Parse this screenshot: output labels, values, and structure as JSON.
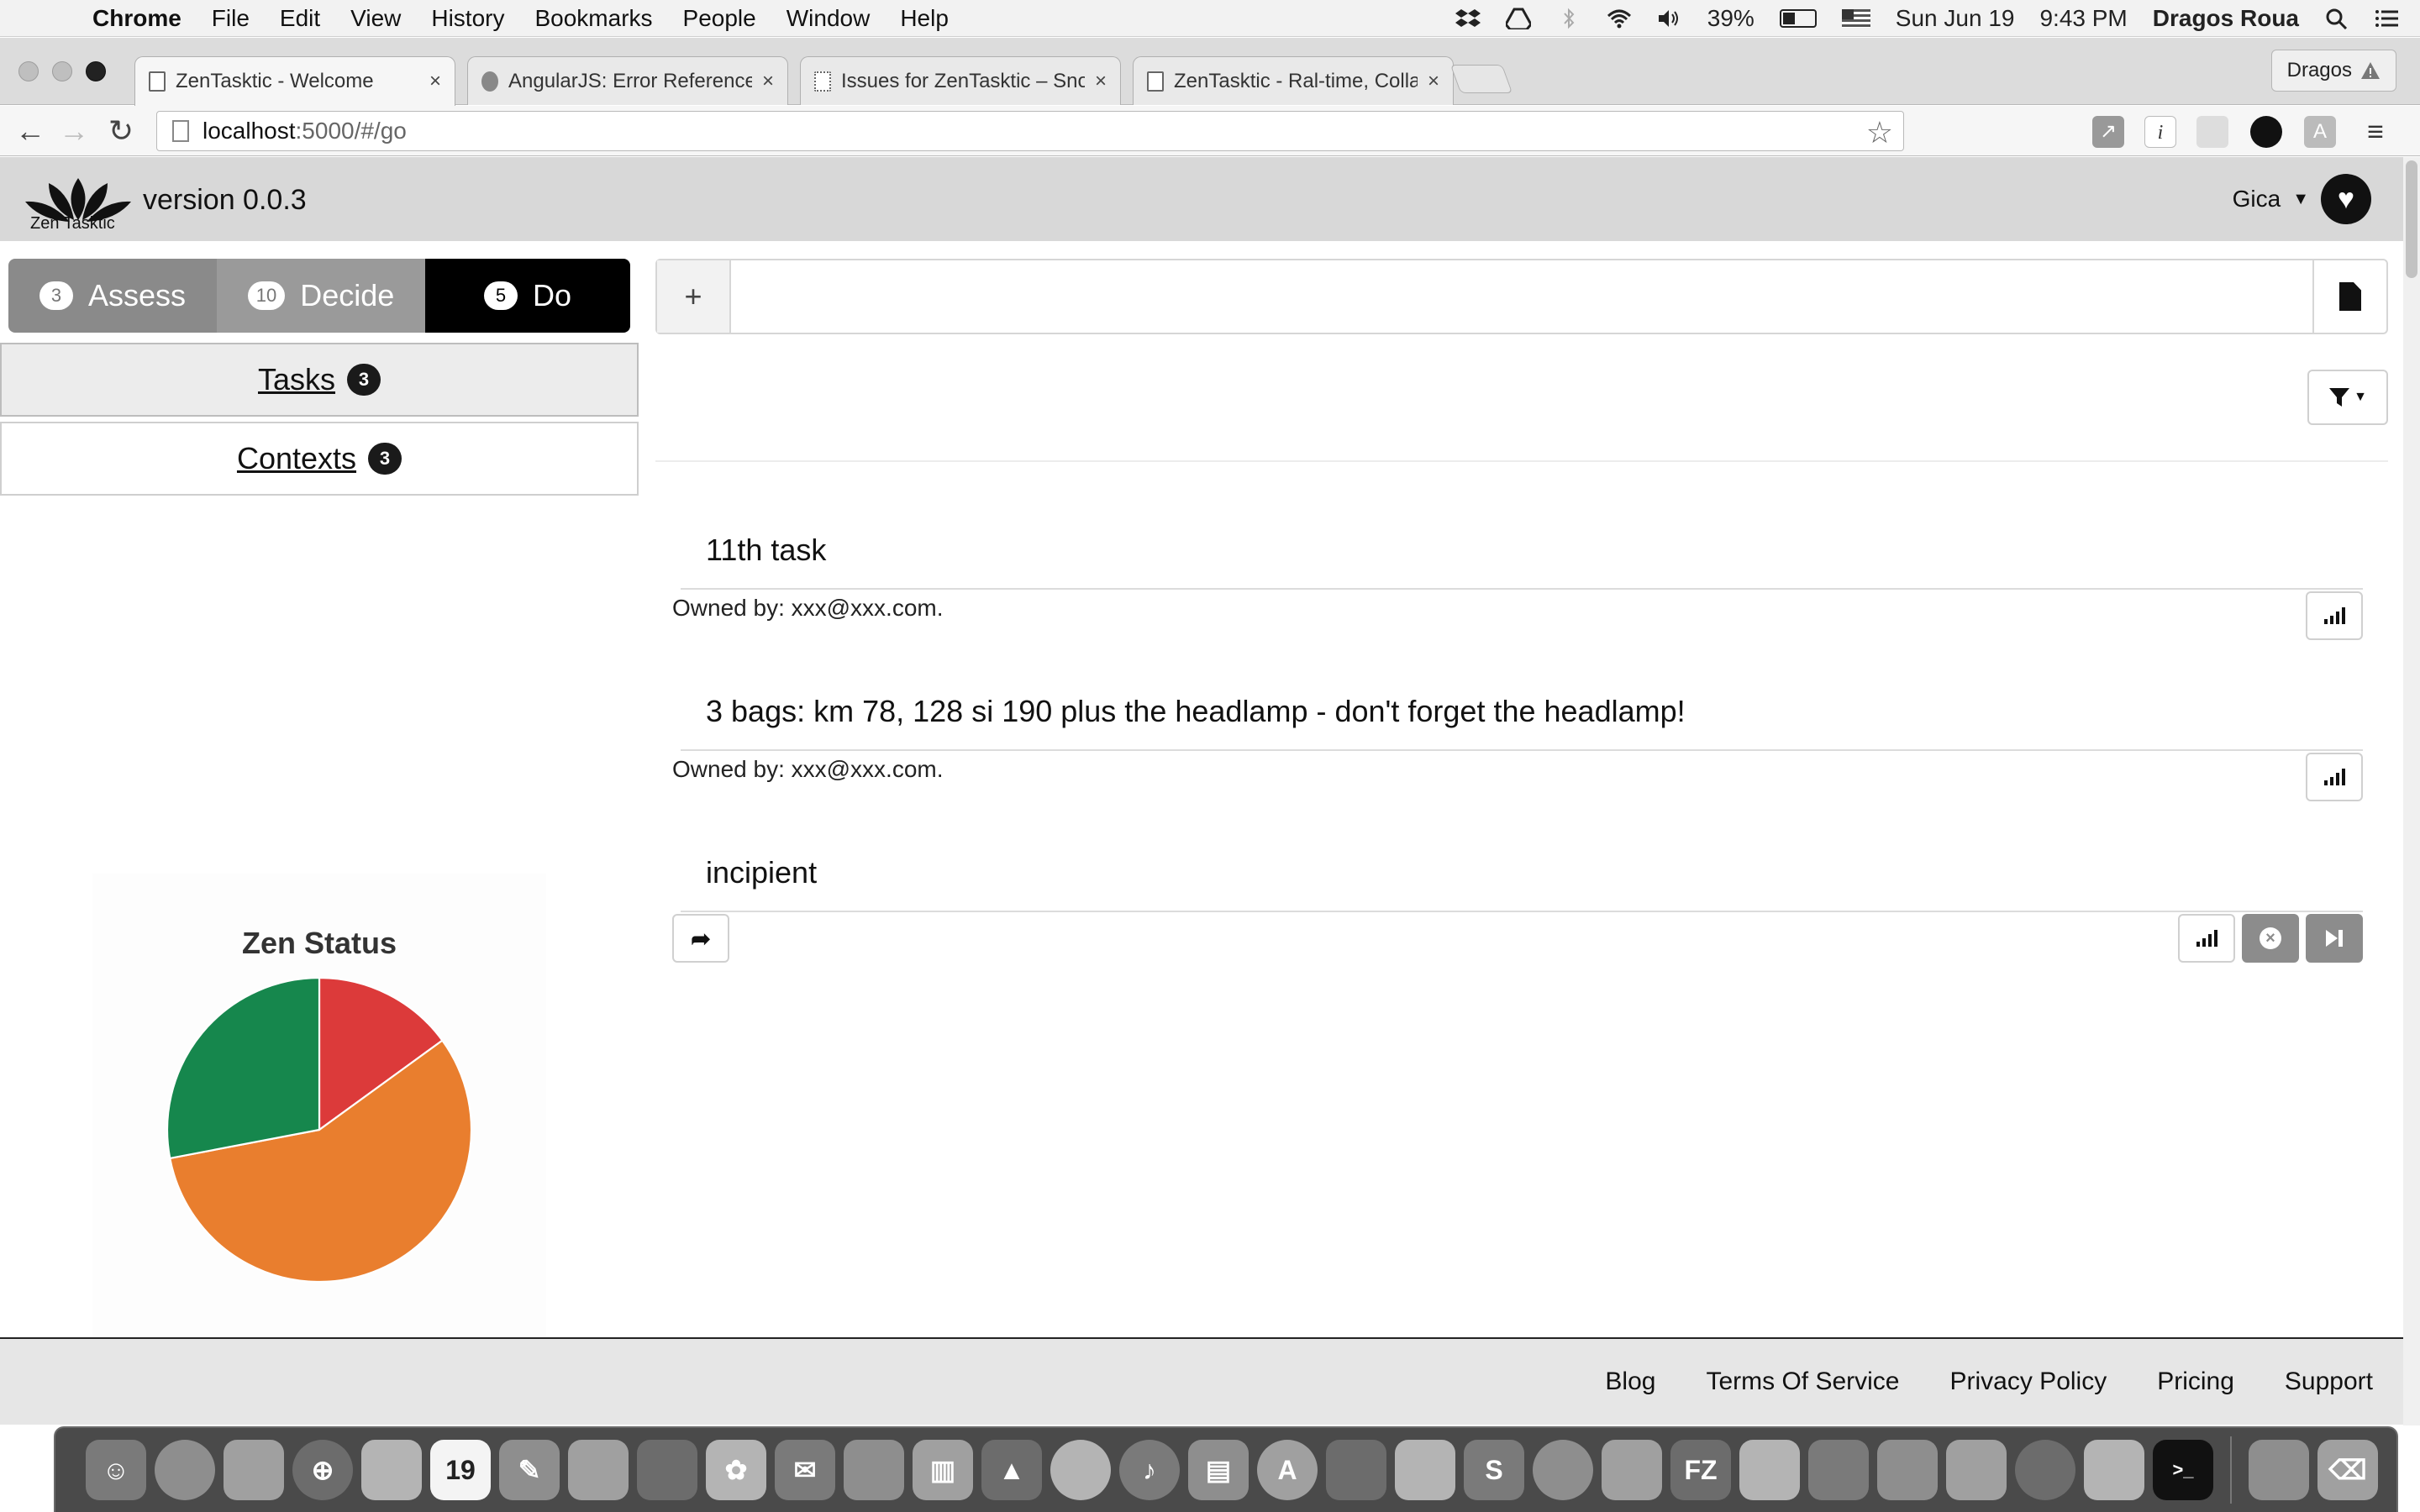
{
  "menubar": {
    "app_name": "Chrome",
    "menus": [
      "File",
      "Edit",
      "View",
      "History",
      "Bookmarks",
      "People",
      "Window",
      "Help"
    ],
    "battery_percent": "39%",
    "battery_level": 0.39,
    "date": "Sun Jun 19",
    "time": "9:43 PM",
    "user": "Dragos Roua"
  },
  "browser": {
    "tabs": [
      {
        "title": "ZenTasktic - Welcome",
        "active": true
      },
      {
        "title": "AngularJS: Error Reference",
        "active": false
      },
      {
        "title": "Issues for ZenTasktic – Sno",
        "active": false
      },
      {
        "title": "ZenTasktic - Ral-time, Colla",
        "active": false
      }
    ],
    "profile_name": "Dragos",
    "url_host": "localhost",
    "url_path": ":5000/#/go"
  },
  "app": {
    "logo_text": "Zen Tasktic",
    "version": "version 0.0.3",
    "user_name": "Gica",
    "modes": [
      {
        "label": "Assess",
        "count": "3"
      },
      {
        "label": "Decide",
        "count": "10"
      },
      {
        "label": "Do",
        "count": "5"
      }
    ],
    "sidenav": [
      {
        "label": "Tasks",
        "count": "3"
      },
      {
        "label": "Contexts",
        "count": "3"
      }
    ],
    "zen_status": {
      "title": "Zen Status"
    },
    "add_task": {
      "add_label": "+",
      "placeholder": ""
    },
    "tasks": [
      {
        "title": "11th task",
        "owner": "Owned by: xxx@xxx.com."
      },
      {
        "title": "3 bags: km 78, 128 si 190 plus the headlamp - don't forget the headlamp!",
        "owner": "Owned by: xxx@xxx.com."
      },
      {
        "title": "incipient",
        "owner": ""
      }
    ],
    "footer_links": [
      "Blog",
      "Terms Of Service",
      "Privacy Policy",
      "Pricing",
      "Support"
    ]
  },
  "chart_data": {
    "type": "pie",
    "title": "Zen Status",
    "values": [
      15,
      57,
      28
    ],
    "colors": [
      "#dc3a3a",
      "#e97e2e",
      "#16874d"
    ]
  },
  "colors": {
    "mode_do_active": "#000000",
    "header_bg": "#d8d8d8"
  },
  "dock": {
    "icons": [
      "finder-icon",
      "launchpad-icon",
      "mission-control-icon",
      "safari-icon",
      "photo-booth-icon",
      "calendar-icon",
      "notes-icon",
      "preview-icon",
      "facetime-icon",
      "photos-icon",
      "mail-icon",
      "reminders-icon",
      "numbers-icon",
      "keynote-icon",
      "system-preferences-icon",
      "itunes-icon",
      "ibooks-icon",
      "app-store-icon",
      "image-capture-icon",
      "xcode-icon",
      "sublime-icon",
      "chrome-icon",
      "cyberduck-icon",
      "filezilla-icon",
      "disk-utility-icon",
      "image-app-icon",
      "automator-icon",
      "alfred-icon",
      "simplenote-icon",
      "quill-icon",
      "terminal-icon",
      "documents-icon",
      "trash-icon"
    ],
    "calendar_day": "19"
  }
}
